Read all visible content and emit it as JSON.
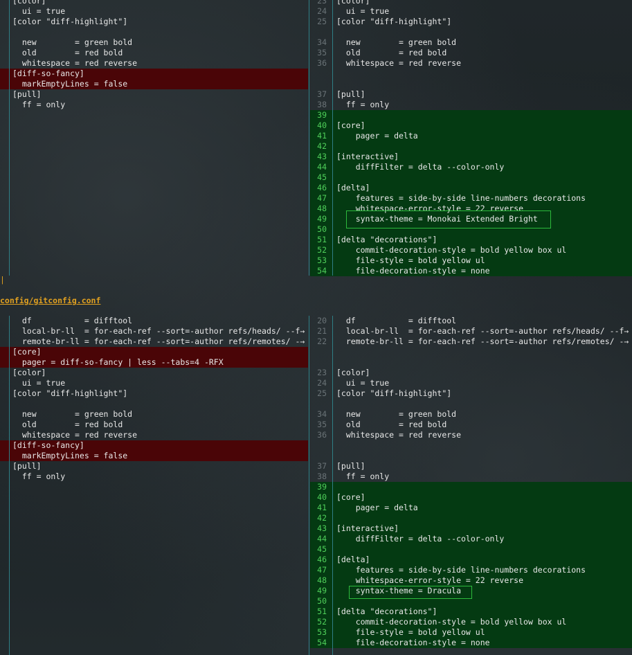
{
  "file_header": "config/gitconfig.conf",
  "pane1": {
    "left": [
      {
        "n": "",
        "text": "[color]",
        "kind": "ctx"
      },
      {
        "n": "",
        "text": "  ui = true",
        "kind": "ctx"
      },
      {
        "n": "",
        "text": "[color \"diff-highlight\"]",
        "kind": "ctx"
      },
      {
        "n": "",
        "text": "",
        "kind": "ctx"
      },
      {
        "n": "",
        "text": "  new        = green bold",
        "kind": "ctx"
      },
      {
        "n": "",
        "text": "  old        = red bold",
        "kind": "ctx"
      },
      {
        "n": "",
        "text": "  whitespace = red reverse",
        "kind": "ctx"
      },
      {
        "n": "",
        "text": "[diff-so-fancy]",
        "kind": "del"
      },
      {
        "n": "",
        "text": "  markEmptyLines = false",
        "kind": "del"
      },
      {
        "n": "",
        "text": "[pull]",
        "kind": "ctx"
      },
      {
        "n": "",
        "text": "  ff = only",
        "kind": "ctx"
      }
    ],
    "right": [
      {
        "n": "23",
        "text": "[color]",
        "kind": "ctx"
      },
      {
        "n": "24",
        "text": "  ui = true",
        "kind": "ctx"
      },
      {
        "n": "25",
        "text": "[color \"diff-highlight\"]",
        "kind": "ctx"
      },
      {
        "n": "",
        "text": "",
        "kind": "ctx"
      },
      {
        "n": "34",
        "text": "  new        = green bold",
        "kind": "ctx"
      },
      {
        "n": "35",
        "text": "  old        = red bold",
        "kind": "ctx"
      },
      {
        "n": "36",
        "text": "  whitespace = red reverse",
        "kind": "ctx"
      },
      {
        "n": "",
        "text": "",
        "kind": "ctx"
      },
      {
        "n": "",
        "text": "",
        "kind": "ctx"
      },
      {
        "n": "37",
        "text": "[pull]",
        "kind": "ctx"
      },
      {
        "n": "38",
        "text": "  ff = only",
        "kind": "ctx"
      },
      {
        "n": "39",
        "text": "",
        "kind": "add"
      },
      {
        "n": "40",
        "text": "[core]",
        "kind": "add"
      },
      {
        "n": "41",
        "text": "    pager = delta",
        "kind": "add"
      },
      {
        "n": "42",
        "text": "",
        "kind": "add"
      },
      {
        "n": "43",
        "text": "[interactive]",
        "kind": "add"
      },
      {
        "n": "44",
        "text": "    diffFilter = delta --color-only",
        "kind": "add"
      },
      {
        "n": "45",
        "text": "",
        "kind": "add"
      },
      {
        "n": "46",
        "text": "[delta]",
        "kind": "add"
      },
      {
        "n": "47",
        "text": "    features = side-by-side line-numbers decorations",
        "kind": "add"
      },
      {
        "n": "48",
        "text": "    whitespace-error-style = 22 reverse",
        "kind": "add"
      },
      {
        "n": "49",
        "text": "    syntax-theme = Monokai Extended Bright",
        "kind": "add"
      },
      {
        "n": "50",
        "text": "",
        "kind": "add"
      },
      {
        "n": "51",
        "text": "[delta \"decorations\"]",
        "kind": "add"
      },
      {
        "n": "52",
        "text": "    commit-decoration-style = bold yellow box ul",
        "kind": "add"
      },
      {
        "n": "53",
        "text": "    file-style = bold yellow ul",
        "kind": "add"
      },
      {
        "n": "54",
        "text": "    file-decoration-style = none",
        "kind": "add"
      }
    ]
  },
  "pane2": {
    "left": [
      {
        "n": "",
        "text": "  df           = difftool",
        "kind": "ctx"
      },
      {
        "n": "",
        "text": "  local-br-ll  = for-each-ref --sort=-author refs/heads/ --f→",
        "kind": "ctx"
      },
      {
        "n": "",
        "text": "  remote-br-ll = for-each-ref --sort=-author refs/remotes/ -→",
        "kind": "ctx"
      },
      {
        "n": "",
        "text": "[core]",
        "kind": "del"
      },
      {
        "n": "",
        "text": "  pager = diff-so-fancy | less --tabs=4 -RFX",
        "kind": "del"
      },
      {
        "n": "",
        "text": "[color]",
        "kind": "ctx"
      },
      {
        "n": "",
        "text": "  ui = true",
        "kind": "ctx"
      },
      {
        "n": "",
        "text": "[color \"diff-highlight\"]",
        "kind": "ctx"
      },
      {
        "n": "",
        "text": "",
        "kind": "ctx"
      },
      {
        "n": "",
        "text": "  new        = green bold",
        "kind": "ctx"
      },
      {
        "n": "",
        "text": "  old        = red bold",
        "kind": "ctx"
      },
      {
        "n": "",
        "text": "  whitespace = red reverse",
        "kind": "ctx"
      },
      {
        "n": "",
        "text": "[diff-so-fancy]",
        "kind": "del"
      },
      {
        "n": "",
        "text": "  markEmptyLines = false",
        "kind": "del"
      },
      {
        "n": "",
        "text": "[pull]",
        "kind": "ctx"
      },
      {
        "n": "",
        "text": "  ff = only",
        "kind": "ctx"
      }
    ],
    "right": [
      {
        "n": "20",
        "text": "  df           = difftool",
        "kind": "ctx"
      },
      {
        "n": "21",
        "text": "  local-br-ll  = for-each-ref --sort=-author refs/heads/ --f→",
        "kind": "ctx"
      },
      {
        "n": "22",
        "text": "  remote-br-ll = for-each-ref --sort=-author refs/remotes/ -→",
        "kind": "ctx"
      },
      {
        "n": "",
        "text": "",
        "kind": "ctx"
      },
      {
        "n": "",
        "text": "",
        "kind": "ctx"
      },
      {
        "n": "23",
        "text": "[color]",
        "kind": "ctx"
      },
      {
        "n": "24",
        "text": "  ui = true",
        "kind": "ctx"
      },
      {
        "n": "25",
        "text": "[color \"diff-highlight\"]",
        "kind": "ctx"
      },
      {
        "n": "",
        "text": "",
        "kind": "ctx"
      },
      {
        "n": "34",
        "text": "  new        = green bold",
        "kind": "ctx"
      },
      {
        "n": "35",
        "text": "  old        = red bold",
        "kind": "ctx"
      },
      {
        "n": "36",
        "text": "  whitespace = red reverse",
        "kind": "ctx"
      },
      {
        "n": "",
        "text": "",
        "kind": "ctx"
      },
      {
        "n": "",
        "text": "",
        "kind": "ctx"
      },
      {
        "n": "37",
        "text": "[pull]",
        "kind": "ctx"
      },
      {
        "n": "38",
        "text": "  ff = only",
        "kind": "ctx"
      },
      {
        "n": "39",
        "text": "",
        "kind": "add"
      },
      {
        "n": "40",
        "text": "[core]",
        "kind": "add"
      },
      {
        "n": "41",
        "text": "    pager = delta",
        "kind": "add"
      },
      {
        "n": "42",
        "text": "",
        "kind": "add"
      },
      {
        "n": "43",
        "text": "[interactive]",
        "kind": "add"
      },
      {
        "n": "44",
        "text": "    diffFilter = delta --color-only",
        "kind": "add"
      },
      {
        "n": "45",
        "text": "",
        "kind": "add"
      },
      {
        "n": "46",
        "text": "[delta]",
        "kind": "add"
      },
      {
        "n": "47",
        "text": "    features = side-by-side line-numbers decorations",
        "kind": "add"
      },
      {
        "n": "48",
        "text": "    whitespace-error-style = 22 reverse",
        "kind": "add"
      },
      {
        "n": "49",
        "text": "    syntax-theme = Dracula",
        "kind": "add"
      },
      {
        "n": "50",
        "text": "",
        "kind": "add"
      },
      {
        "n": "51",
        "text": "[delta \"decorations\"]",
        "kind": "add"
      },
      {
        "n": "52",
        "text": "    commit-decoration-style = bold yellow box ul",
        "kind": "add"
      },
      {
        "n": "53",
        "text": "    file-style = bold yellow ul",
        "kind": "add"
      },
      {
        "n": "54",
        "text": "    file-decoration-style = none",
        "kind": "add"
      }
    ]
  }
}
